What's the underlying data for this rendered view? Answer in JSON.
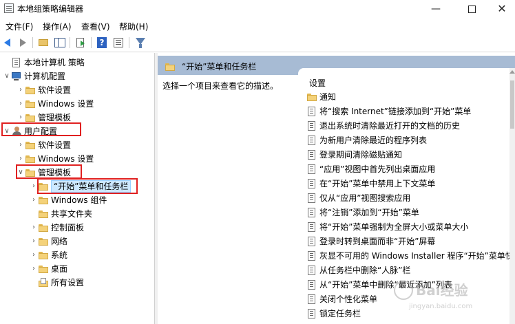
{
  "window": {
    "title": "本地组策略编辑器",
    "minimize_glyph": "—",
    "close_glyph": "✕"
  },
  "menu": [
    {
      "label": "文件(F)"
    },
    {
      "label": "操作(A)"
    },
    {
      "label": "查看(V)"
    },
    {
      "label": "帮助(H)"
    }
  ],
  "toolbar": {
    "icons": [
      "back-arrow-icon",
      "forward-arrow-icon",
      "up-folder-icon",
      "show-hide-tree-icon",
      "export-list-icon",
      "help-icon",
      "properties-icon",
      "filter-icon"
    ],
    "help_glyph": "?"
  },
  "tree": {
    "rows": [
      {
        "label": "本地计算机 策略",
        "icon": "policy-icon",
        "expander": ""
      },
      {
        "label": "计算机配置",
        "icon": "computer-icon",
        "expander": "∨"
      },
      {
        "label": "软件设置",
        "icon": "folder-icon",
        "expander": "›"
      },
      {
        "label": "Windows 设置",
        "icon": "folder-icon",
        "expander": "›"
      },
      {
        "label": "管理模板",
        "icon": "folder-icon",
        "expander": "›"
      },
      {
        "label": "用户配置",
        "icon": "user-icon",
        "expander": "∨"
      },
      {
        "label": "软件设置",
        "icon": "folder-icon",
        "expander": "›"
      },
      {
        "label": "Windows 设置",
        "icon": "folder-icon",
        "expander": "›"
      },
      {
        "label": "管理模板",
        "icon": "folder-icon",
        "expander": "∨"
      },
      {
        "label": "“开始”菜单和任务栏",
        "icon": "folder-icon",
        "expander": "›"
      },
      {
        "label": "Windows 组件",
        "icon": "folder-icon",
        "expander": "›"
      },
      {
        "label": "共享文件夹",
        "icon": "folder-icon",
        "expander": ""
      },
      {
        "label": "控制面板",
        "icon": "folder-icon",
        "expander": "›"
      },
      {
        "label": "网络",
        "icon": "folder-icon",
        "expander": "›"
      },
      {
        "label": "系统",
        "icon": "folder-icon",
        "expander": "›"
      },
      {
        "label": "桌面",
        "icon": "folder-icon",
        "expander": "›"
      },
      {
        "label": "所有设置",
        "icon": "settings-icon",
        "expander": ""
      }
    ]
  },
  "right": {
    "header_title": "“开始”菜单和任务栏",
    "description": "选择一个项目来查看它的描述。",
    "column_header": "设置",
    "items": [
      {
        "label": "通知",
        "icon": "folder-icon"
      },
      {
        "label": "将“搜索 Internet”链接添加到“开始”菜单",
        "icon": "policy-icon"
      },
      {
        "label": "退出系统时清除最近打开的文档的历史",
        "icon": "policy-icon"
      },
      {
        "label": "为新用户清除最近的程序列表",
        "icon": "policy-icon"
      },
      {
        "label": "登录期间清除磁贴通知",
        "icon": "policy-icon"
      },
      {
        "label": "“应用”视图中首先列出桌面应用",
        "icon": "policy-icon"
      },
      {
        "label": "在“开始”菜单中禁用上下文菜单",
        "icon": "policy-icon"
      },
      {
        "label": "仅从“应用”视图搜索应用",
        "icon": "policy-icon"
      },
      {
        "label": "将“注销”添加到“开始”菜单",
        "icon": "policy-icon"
      },
      {
        "label": "将“开始”菜单强制为全屏大小或菜单大小",
        "icon": "policy-icon"
      },
      {
        "label": "登录时转到桌面而非“开始”屏幕",
        "icon": "policy-icon"
      },
      {
        "label": "灰显不可用的 Windows Installer 程序“开始”菜单快",
        "icon": "policy-icon"
      },
      {
        "label": "从任务栏中删除“人脉”栏",
        "icon": "policy-icon"
      },
      {
        "label": "从“开始”菜单中删除“最近添加”列表",
        "icon": "policy-icon"
      },
      {
        "label": "关闭个性化菜单",
        "icon": "policy-icon"
      },
      {
        "label": "锁定任务栏",
        "icon": "policy-icon"
      }
    ]
  },
  "watermark": {
    "title": "Bai经验",
    "subtitle": "jingyan.baidu.com"
  },
  "colors": {
    "header_band": "#a7bbd4",
    "highlight_box": "#e02020",
    "selection": "#cce8ff"
  }
}
